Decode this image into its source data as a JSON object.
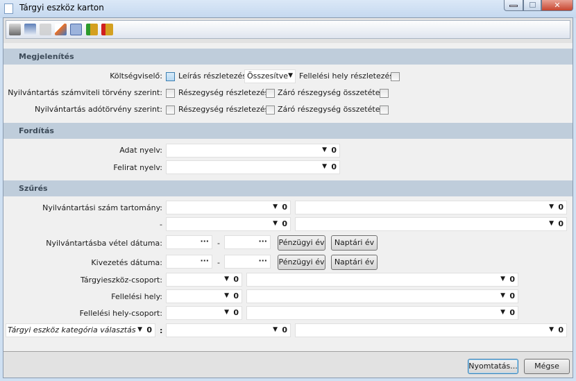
{
  "window": {
    "title": "Tárgyi eszköz karton",
    "minimize": "minimize",
    "maximize": "maximize",
    "close": "close"
  },
  "toolbar": [
    "print-icon",
    "print-preview-icon",
    "copy-icon",
    "edit-icon",
    "calculator-icon",
    "coins-import-icon",
    "coins-export-icon"
  ],
  "sections": {
    "display": "Megjelenítés",
    "translation": "Fordítás",
    "filter": "Szűrés"
  },
  "display": {
    "cost_bearer": "Költségviselő:",
    "description_detail": "Leírás részletezés:",
    "description_detail_value": "Összesítve",
    "location_detail": "Fellelési hely részletezés:",
    "accounting_law": "Nyilvántartás számviteli törvény szerint:",
    "tax_law": "Nyilvántartás adótörvény szerint:",
    "subunit_detail": "Részegység részletezés:",
    "closing_subunit": "Záró részegység összetétel:"
  },
  "translation": {
    "data_lang": "Adat nyelv:",
    "caption_lang": "Felirat nyelv:"
  },
  "filter": {
    "reg_range": "Nyilvántartási szám tartomány:",
    "dash": "-",
    "reg_date": "Nyilvántartásba vétel dátuma:",
    "disposal_date": "Kivezetés dátuma:",
    "fiscal_year": "Pénzügyi év",
    "calendar_year": "Naptári év",
    "ellipsis": "···",
    "group": "Tárgyieszköz-csoport:",
    "location": "Fellelési hely:",
    "location_group": "Fellelési hely-csoport:",
    "category": "Tárgyi eszköz kategória választás",
    "colon": ":"
  },
  "buttons": {
    "print": "Nyomtatás...",
    "cancel": "Mégse"
  }
}
